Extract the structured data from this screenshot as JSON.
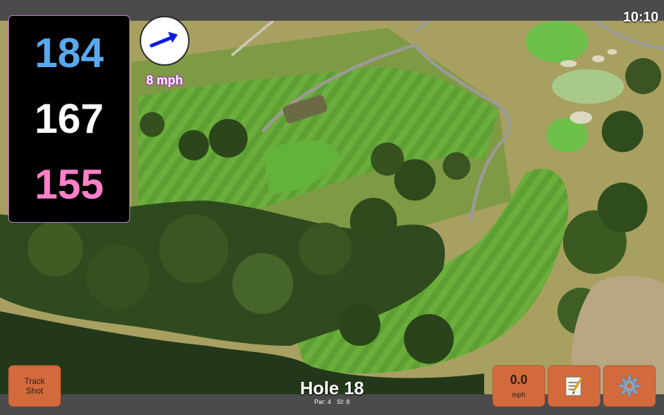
{
  "status": {
    "time": "10:10"
  },
  "yardage": {
    "back": "184",
    "middle": "167",
    "front": "155"
  },
  "wind": {
    "speed_label": "8 mph",
    "arrow_icon": "arrow-right-icon",
    "arrow_color": "#0a1ee0"
  },
  "buttons": {
    "track_shot_line1": "Track",
    "track_shot_line2": "Shot",
    "speed_value": "0.0",
    "speed_unit": "mph",
    "notes_icon": "memo-icon",
    "settings_icon": "gear-icon"
  },
  "hole": {
    "title": "Hole 18",
    "par": "Par: 4",
    "si": "SI: 8"
  },
  "colors": {
    "button_bg": "#d26a3c",
    "border_accent": "#c67ad2"
  }
}
